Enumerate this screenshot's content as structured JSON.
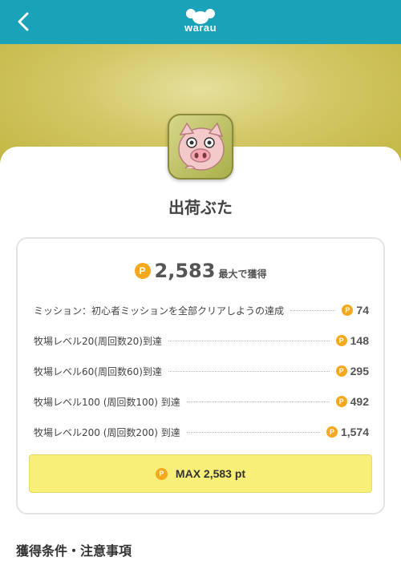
{
  "header": {
    "logo_text": "warau"
  },
  "app": {
    "title": "出荷ぶた"
  },
  "points": {
    "coin_symbol": "P",
    "total": "2,583",
    "total_suffix": "最大で獲得",
    "rows": [
      {
        "label": "ミッション：初心者ミッションを全部クリアしようの達成",
        "pt": "74"
      },
      {
        "label": "牧場レベル20(周回数20)到達",
        "pt": "148"
      },
      {
        "label": "牧場レベル60(周回数60)到達",
        "pt": "295"
      },
      {
        "label": "牧場レベル100 (周回数100) 到達",
        "pt": "492"
      },
      {
        "label": "牧場レベル200 (周回数200) 到達",
        "pt": "1,574"
      }
    ],
    "max_label": "MAX 2,583 pt"
  },
  "section": {
    "title": "獲得条件・注意事項"
  },
  "colors": {
    "header": "#1aa3b8",
    "coin": "#f5a81c",
    "max_button": "#f8ef79"
  }
}
